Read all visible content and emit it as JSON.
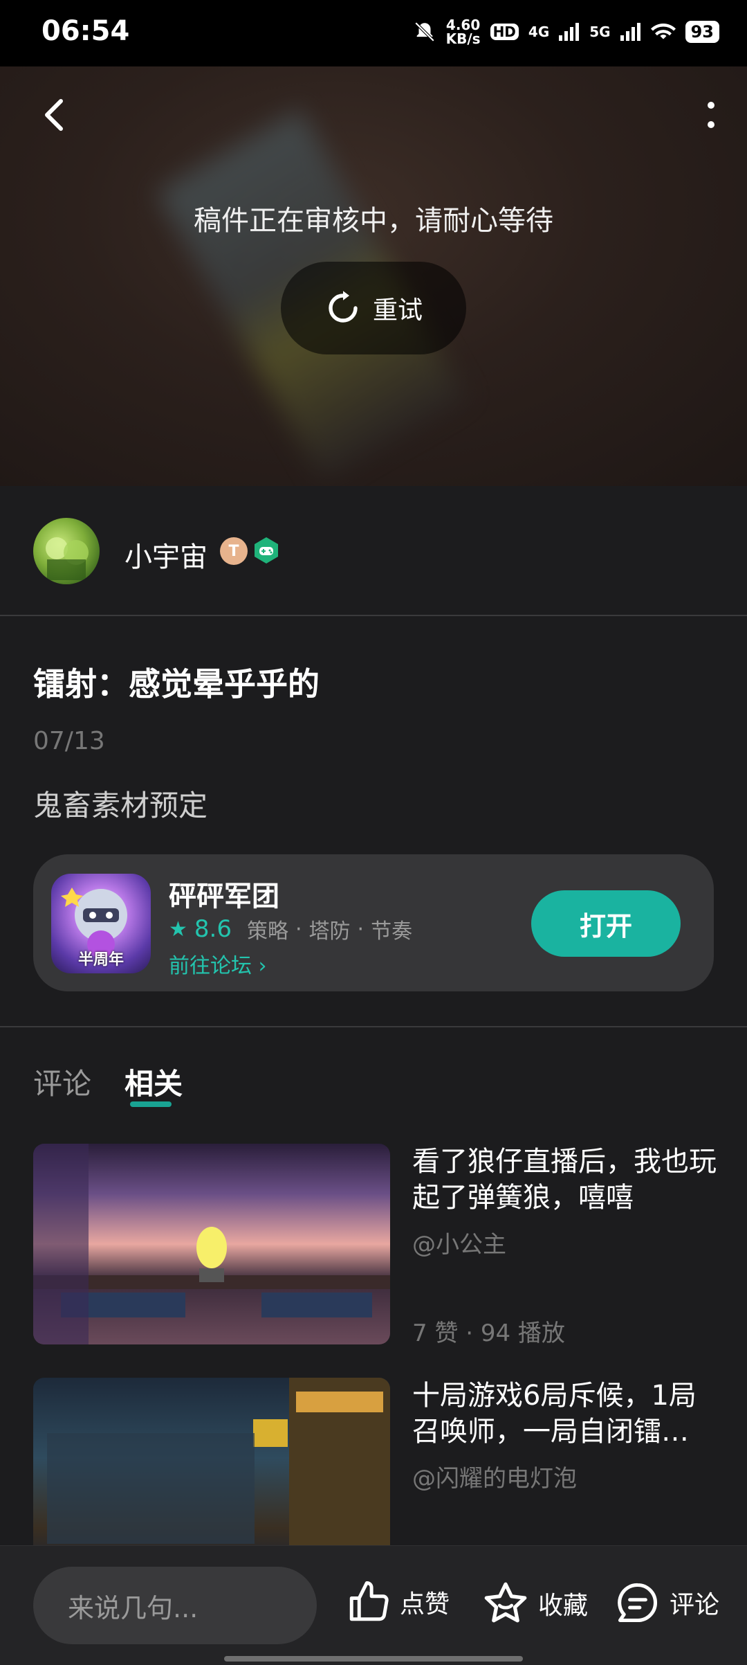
{
  "status_bar": {
    "time": "06:54",
    "net_speed_value": "4.60",
    "net_speed_unit": "KB/s",
    "hd": "HD",
    "signal1": "4G",
    "signal2": "5G",
    "battery": "93"
  },
  "hero": {
    "message": "稿件正在审核中，请耐心等待",
    "retry_label": "重试"
  },
  "author": {
    "name": "小宇宙",
    "badge_letter": "T"
  },
  "post": {
    "title": "镭射：感觉晕乎乎的",
    "date": "07/13",
    "description": "鬼畜素材预定"
  },
  "game_card": {
    "name": "砰砰军团",
    "rating": "8.6",
    "tags": [
      "策略",
      "塔防",
      "节奏"
    ],
    "forum_link": "前往论坛",
    "open_label": "打开",
    "icon_label": "半周年"
  },
  "tabs": [
    {
      "label": "评论"
    },
    {
      "label": "相关"
    }
  ],
  "related": [
    {
      "title": "看了狼仔直播后，我也玩起了弹簧狼，嘻嘻",
      "author": "@小公主",
      "stats": "7 赞 · 94 播放"
    },
    {
      "title": "十局游戏6局斥候，1局召唤师，一局自闭镭…",
      "author": "@闪耀的电灯泡",
      "stats": ""
    }
  ],
  "bottom_bar": {
    "comment_placeholder": "来说几句...",
    "like_label": "点赞",
    "favorite_label": "收藏",
    "comment_label": "评论"
  },
  "colors": {
    "accent": "#1ab3a0",
    "background": "#1c1c1e",
    "card": "#363638"
  }
}
